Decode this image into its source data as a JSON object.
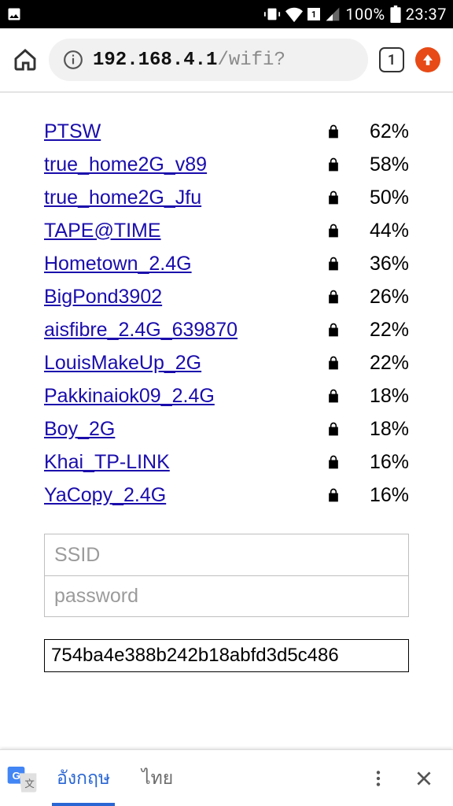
{
  "status": {
    "battery_text": "100%",
    "time": "23:37",
    "sim_label": "1"
  },
  "browser": {
    "url_main": "192.168.4.1",
    "url_rest": "/wifi?",
    "tab_count": "1"
  },
  "wifi_networks": [
    {
      "ssid": "PTSW",
      "locked": true,
      "signal": "62%"
    },
    {
      "ssid": "true_home2G_v89",
      "locked": true,
      "signal": "58%"
    },
    {
      "ssid": "true_home2G_Jfu",
      "locked": true,
      "signal": "50%"
    },
    {
      "ssid": "TAPE@TIME",
      "locked": true,
      "signal": "44%"
    },
    {
      "ssid": "Hometown_2.4G",
      "locked": true,
      "signal": "36%"
    },
    {
      "ssid": "BigPond3902",
      "locked": true,
      "signal": "26%"
    },
    {
      "ssid": "aisfibre_2.4G_639870",
      "locked": true,
      "signal": "22%"
    },
    {
      "ssid": "LouisMakeUp_2G",
      "locked": true,
      "signal": "22%"
    },
    {
      "ssid": "Pakkinaiok09_2.4G",
      "locked": true,
      "signal": "18%"
    },
    {
      "ssid": "Boy_2G",
      "locked": true,
      "signal": "18%"
    },
    {
      "ssid": "Khai_TP-LINK",
      "locked": true,
      "signal": "16%"
    },
    {
      "ssid": "YaCopy_2.4G",
      "locked": true,
      "signal": "16%"
    }
  ],
  "form": {
    "ssid_placeholder": "SSID",
    "password_placeholder": "password",
    "api_value": "754ba4e388b242b18abfd3d5c486"
  },
  "translate": {
    "lang1": "อังกฤษ",
    "lang2": "ไทย"
  }
}
